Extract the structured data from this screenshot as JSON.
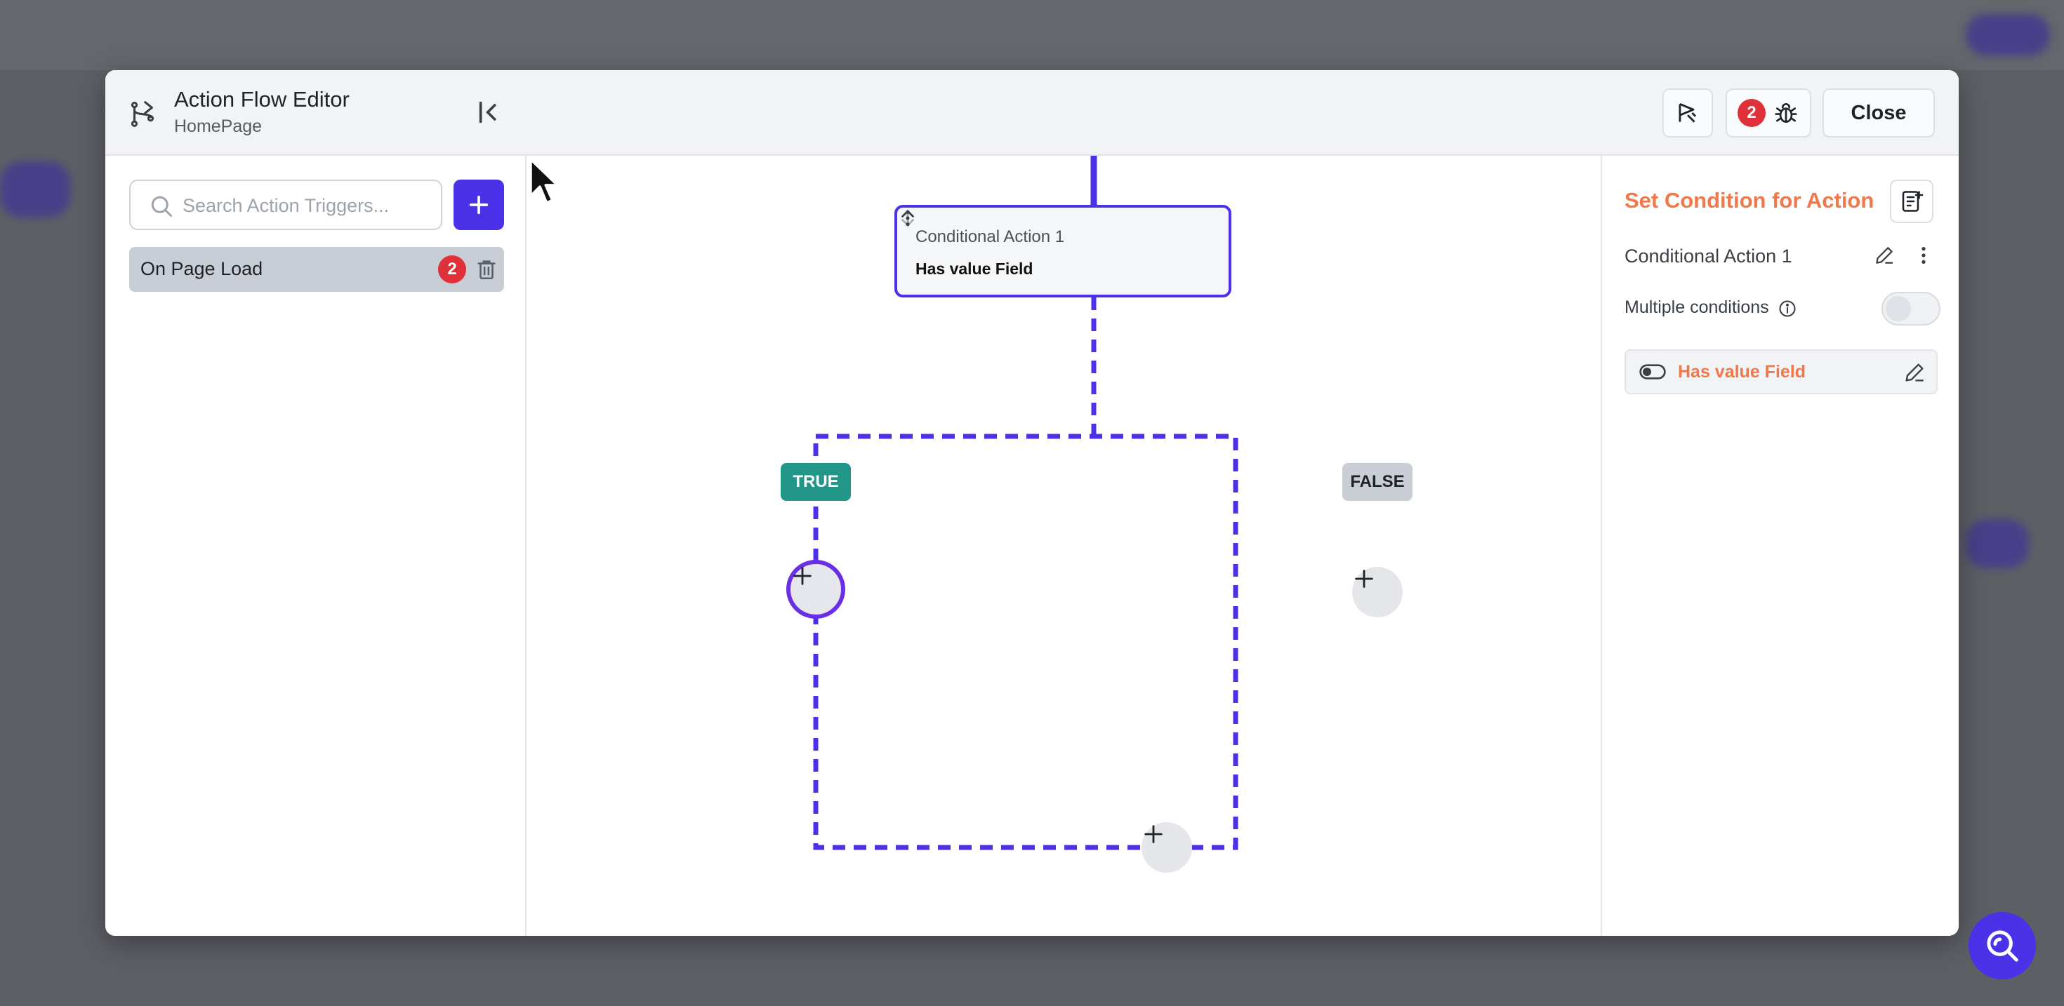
{
  "header": {
    "title": "Action Flow Editor",
    "subtitle": "HomePage"
  },
  "sidebar": {
    "search_placeholder": "Search Action Triggers...",
    "triggers": [
      {
        "label": "On Page Load",
        "badge": "2"
      }
    ]
  },
  "toolbar": {
    "debug_count": "2",
    "close_label": "Close"
  },
  "canvas": {
    "node": {
      "title": "Conditional Action 1",
      "condition": "Has value Field"
    },
    "true_label": "TRUE",
    "false_label": "FALSE"
  },
  "panel": {
    "title": "Set Condition for Action",
    "action_name": "Conditional Action 1",
    "multiple_conditions_label": "Multiple conditions",
    "multiple_conditions_enabled": false,
    "condition_label": "Has value Field"
  },
  "colors": {
    "accent": "#4b32e8",
    "true": "#23968a",
    "false": "#c9cdd4",
    "panel_title": "#f0784a",
    "badge": "#e0303a"
  },
  "icons": [
    "flow-icon",
    "collapse-panel-icon",
    "search-icon",
    "plus-icon",
    "trash-icon",
    "flag-icon",
    "bug-icon",
    "arrow-up-icon",
    "arrow-down-icon",
    "more-vertical-icon",
    "note-icon",
    "edit-icon",
    "info-icon",
    "toggle-icon",
    "cursor-icon",
    "help-search-icon"
  ]
}
